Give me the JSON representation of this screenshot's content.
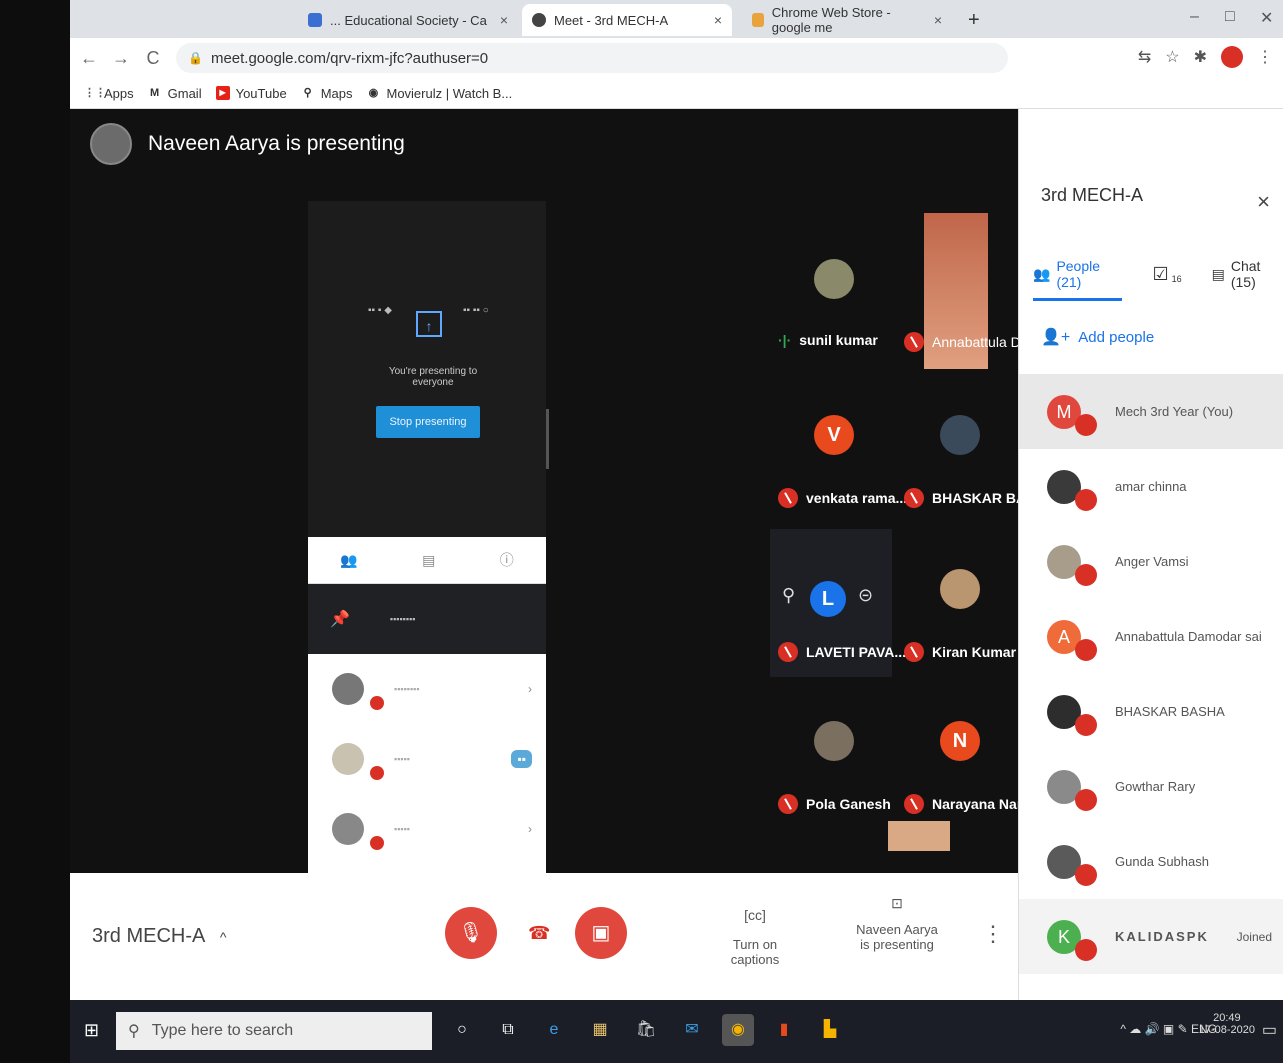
{
  "browser": {
    "tabs": [
      {
        "label": "... Educational Society - Ca",
        "close": "×"
      },
      {
        "label": "Meet - 3rd MECH-A",
        "close": "×"
      },
      {
        "label": "Chrome Web Store - google me",
        "close": "×"
      }
    ],
    "new_tab": "+",
    "url": "meet.google.com/qrv-rixm-jfc?authuser=0",
    "bookmarks": [
      {
        "label": "Apps"
      },
      {
        "label": "Gmail"
      },
      {
        "label": "YouTube"
      },
      {
        "label": "Maps"
      },
      {
        "label": "Movierulz | Watch B..."
      }
    ]
  },
  "stage": {
    "presenter_text": "Naveen Aarya is presenting",
    "screen_caption": "You're presenting to everyone",
    "stop_presenting": "Stop presenting"
  },
  "tiles": [
    {
      "name": "sunil kumar",
      "speaking": true
    },
    {
      "name": "Annabattula D..."
    },
    {
      "name": "venkata rama...",
      "letter": "V"
    },
    {
      "name": "BHASKAR BA..."
    },
    {
      "name": "LAVETI PAVA...",
      "letter": "L"
    },
    {
      "name": "Kiran Kumar S..."
    },
    {
      "name": "Pola Ganesh"
    },
    {
      "name": "Narayana Nar...",
      "letter": "N"
    }
  ],
  "side": {
    "title": "3rd MECH-A",
    "close": "×",
    "tabs": {
      "people": "People (21)",
      "tasks_badge": "16",
      "chat": "Chat (15)"
    },
    "add_people": "Add people",
    "people": [
      {
        "name": "Mech 3rd Year (You)",
        "letter": "M",
        "color": "#e0483e"
      },
      {
        "name": "amar chinna",
        "color": "#3a3a3a"
      },
      {
        "name": "Anger Vamsi",
        "color": "#a79d8a"
      },
      {
        "name": "Annabattula Damodar sai",
        "letter": "A",
        "color": "#f06b3a"
      },
      {
        "name": "BHASKAR BASHA",
        "color": "#2d2d2d"
      },
      {
        "name": "Gowthar Rary",
        "color": "#8a8a8a"
      },
      {
        "name": "Gunda Subhash",
        "color": "#5a5a5a"
      },
      {
        "name": "KALIDASPK",
        "letter": "K",
        "color": "#4caf50",
        "status": "Joined"
      }
    ]
  },
  "bottom": {
    "meeting_name": "3rd MECH-A",
    "captions": "Turn on captions",
    "presenting": "Naveen Aarya is presenting"
  },
  "taskbar": {
    "search_placeholder": "Type here to search",
    "time": "20:49",
    "date": "17-08-2020",
    "lang": "ENG"
  }
}
